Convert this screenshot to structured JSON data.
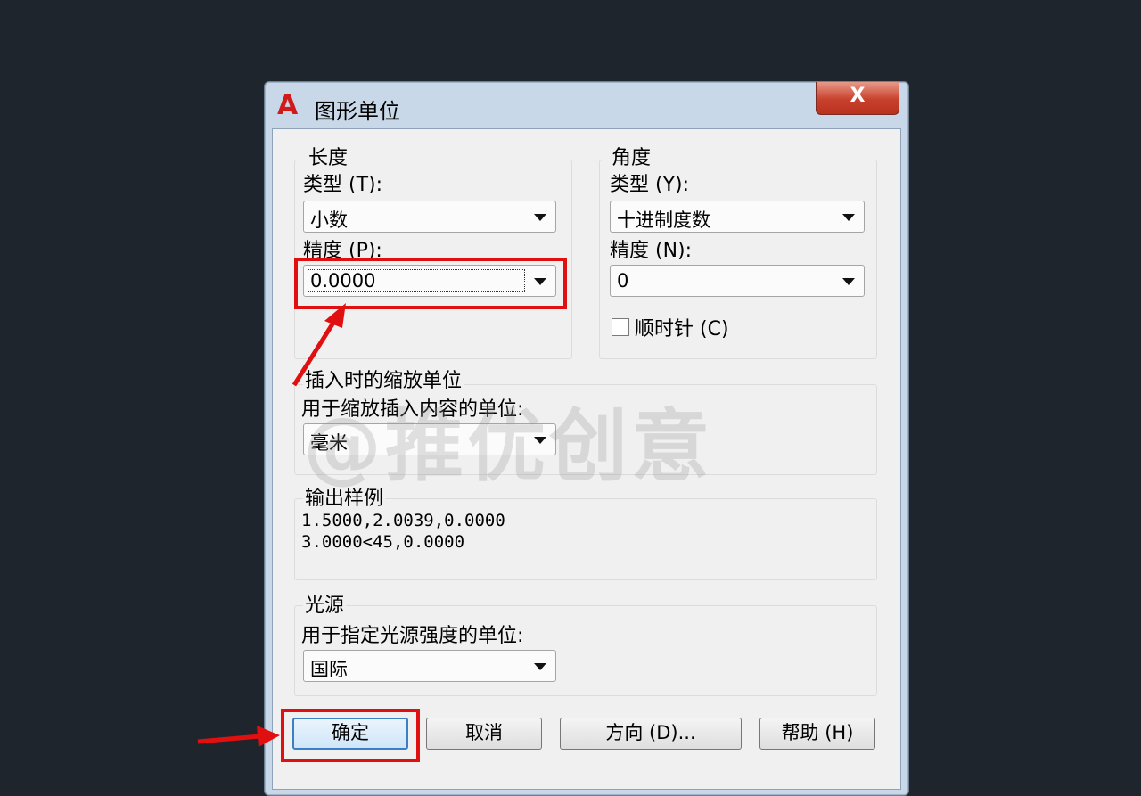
{
  "window": {
    "title": "图形单位",
    "close_label": "X"
  },
  "length": {
    "group_label": "长度",
    "type_label": "类型 (T):",
    "type_value": "小数",
    "precision_label": "精度 (P):",
    "precision_value": "0.0000"
  },
  "angle": {
    "group_label": "角度",
    "type_label": "类型 (Y):",
    "type_value": "十进制度数",
    "precision_label": "精度 (N):",
    "precision_value": "0",
    "clockwise_label": "顺时针 (C)",
    "clockwise_checked": false
  },
  "insertion": {
    "group_label": "插入时的缩放单位",
    "desc_label": "用于缩放插入内容的单位:",
    "value": "毫米"
  },
  "sample_output": {
    "group_label": "输出样例",
    "line1": "1.5000,2.0039,0.0000",
    "line2": "3.0000<45,0.0000"
  },
  "lighting": {
    "group_label": "光源",
    "desc_label": "用于指定光源强度的单位:",
    "value": "国际"
  },
  "buttons": {
    "ok": "确定",
    "cancel": "取消",
    "direction": "方向 (D)...",
    "help": "帮助 (H)"
  },
  "watermark": "@推优创意",
  "colors": {
    "highlight": "#e01010",
    "background": "#1f252d",
    "close_button": "#c8412c"
  }
}
